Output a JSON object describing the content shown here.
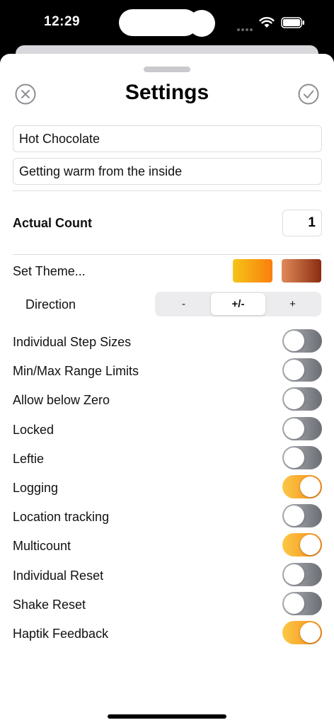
{
  "status": {
    "time": "12:29"
  },
  "header": {
    "title": "Settings",
    "close_icon": "xmark-circle-icon",
    "done_icon": "checkmark-circle-icon"
  },
  "fields": {
    "name": "Hot Chocolate",
    "description": "Getting warm from the inside"
  },
  "actual_count": {
    "label": "Actual Count",
    "value": "1"
  },
  "theme": {
    "label": "Set Theme...",
    "primary_gradient": [
      "#f5c518",
      "#f97d0e"
    ],
    "secondary_gradient": [
      "#e08a5a",
      "#8a2c10"
    ]
  },
  "direction": {
    "label": "Direction",
    "options": [
      "-",
      "+/-",
      "+"
    ],
    "selected": "+/-"
  },
  "colors": {
    "toggle_off": [
      "#b4b7bc",
      "#6a6d73"
    ],
    "toggle_on": [
      "#fbc847",
      "#f98b17"
    ]
  },
  "toggles": [
    {
      "label": "Individual Step Sizes",
      "on": false
    },
    {
      "label": "Min/Max Range Limits",
      "on": false
    },
    {
      "label": "Allow below Zero",
      "on": false
    },
    {
      "label": "Locked",
      "on": false
    },
    {
      "label": "Leftie",
      "on": false
    },
    {
      "label": "Logging",
      "on": true
    },
    {
      "label": "Location tracking",
      "on": false
    },
    {
      "label": "Multicount",
      "on": true
    },
    {
      "label": "Individual Reset",
      "on": false
    },
    {
      "label": "Shake Reset",
      "on": false
    },
    {
      "label": "Haptik Feedback",
      "on": true
    }
  ]
}
